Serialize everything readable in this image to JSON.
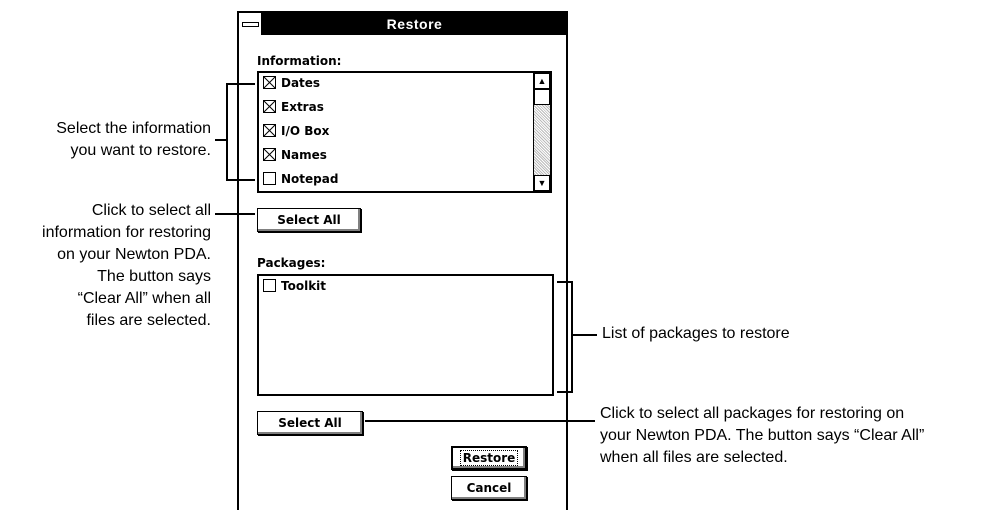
{
  "window": {
    "title": "Restore"
  },
  "information": {
    "label": "Information:",
    "items": [
      {
        "label": "Dates",
        "checked": true
      },
      {
        "label": "Extras",
        "checked": true
      },
      {
        "label": "I/O Box",
        "checked": true
      },
      {
        "label": "Names",
        "checked": true
      },
      {
        "label": "Notepad",
        "checked": false
      }
    ],
    "select_all_label": "Select All"
  },
  "packages": {
    "label": "Packages:",
    "items": [
      {
        "label": "Toolkit",
        "checked": false
      }
    ],
    "select_all_label": "Select All"
  },
  "buttons": {
    "restore": "Restore",
    "cancel": "Cancel"
  },
  "annotations": {
    "select_info": [
      "Select the information",
      "you want to restore."
    ],
    "select_all_info": [
      "Click to select all",
      "information for restoring",
      "on your Newton PDA.",
      "The button says",
      "“Clear All” when all",
      "files are selected."
    ],
    "packages_list": "List of packages to restore",
    "select_all_packages": [
      "Click to select  all packages for restoring on",
      "your Newton PDA. The button says “Clear All”",
      "when all files are selected."
    ]
  }
}
